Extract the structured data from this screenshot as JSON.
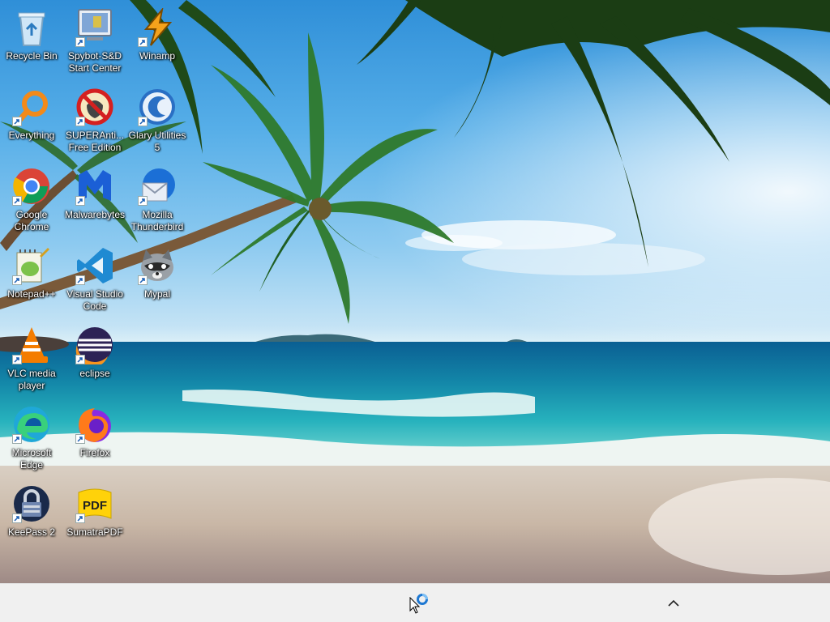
{
  "desktop": {
    "icons": [
      {
        "label": "Recycle Bin",
        "icon": "recycle-bin-icon"
      },
      {
        "label": "Spybot-S&D Start Center",
        "icon": "spybot-icon"
      },
      {
        "label": "Winamp",
        "icon": "winamp-icon"
      },
      {
        "label": "Everything",
        "icon": "everything-search-icon"
      },
      {
        "label": "SUPERAnti... Free Edition",
        "icon": "superantispyware-icon"
      },
      {
        "label": "Glary Utilities 5",
        "icon": "glary-utilities-icon"
      },
      {
        "label": "Google Chrome",
        "icon": "chrome-icon"
      },
      {
        "label": "Malwarebytes",
        "icon": "malwarebytes-icon"
      },
      {
        "label": "Mozilla Thunderbird",
        "icon": "thunderbird-icon"
      },
      {
        "label": "Notepad++",
        "icon": "notepadpp-icon"
      },
      {
        "label": "Visual Studio Code",
        "icon": "vscode-icon"
      },
      {
        "label": "Mypal",
        "icon": "mypal-icon"
      },
      {
        "label": "VLC media player",
        "icon": "vlc-icon"
      },
      {
        "label": "eclipse",
        "icon": "eclipse-icon"
      },
      {
        "label": "Microsoft Edge",
        "icon": "edge-icon"
      },
      {
        "label": "Firefox",
        "icon": "firefox-icon"
      },
      {
        "label": "KeePass 2",
        "icon": "keepass-icon"
      },
      {
        "label": "SumatraPDF",
        "icon": "sumatrapdf-icon"
      }
    ]
  },
  "taskbar": {
    "tray_chevron_icon": "chevron-up-icon",
    "cursor_icon": "busy-cursor-icon",
    "background": "#f0f0f0"
  },
  "wallpaper": {
    "subject": "tropical-beach-wallpaper"
  }
}
